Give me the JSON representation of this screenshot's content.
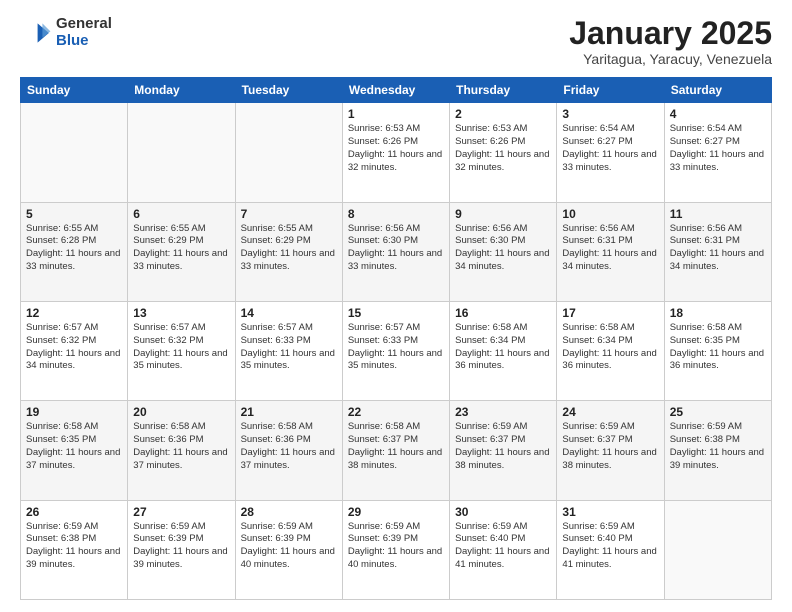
{
  "logo": {
    "general": "General",
    "blue": "Blue"
  },
  "title": "January 2025",
  "subtitle": "Yaritagua, Yaracuy, Venezuela",
  "days": [
    "Sunday",
    "Monday",
    "Tuesday",
    "Wednesday",
    "Thursday",
    "Friday",
    "Saturday"
  ],
  "weeks": [
    [
      {
        "date": "",
        "info": ""
      },
      {
        "date": "",
        "info": ""
      },
      {
        "date": "",
        "info": ""
      },
      {
        "date": "1",
        "info": "Sunrise: 6:53 AM\nSunset: 6:26 PM\nDaylight: 11 hours and 32 minutes."
      },
      {
        "date": "2",
        "info": "Sunrise: 6:53 AM\nSunset: 6:26 PM\nDaylight: 11 hours and 32 minutes."
      },
      {
        "date": "3",
        "info": "Sunrise: 6:54 AM\nSunset: 6:27 PM\nDaylight: 11 hours and 33 minutes."
      },
      {
        "date": "4",
        "info": "Sunrise: 6:54 AM\nSunset: 6:27 PM\nDaylight: 11 hours and 33 minutes."
      }
    ],
    [
      {
        "date": "5",
        "info": "Sunrise: 6:55 AM\nSunset: 6:28 PM\nDaylight: 11 hours and 33 minutes."
      },
      {
        "date": "6",
        "info": "Sunrise: 6:55 AM\nSunset: 6:29 PM\nDaylight: 11 hours and 33 minutes."
      },
      {
        "date": "7",
        "info": "Sunrise: 6:55 AM\nSunset: 6:29 PM\nDaylight: 11 hours and 33 minutes."
      },
      {
        "date": "8",
        "info": "Sunrise: 6:56 AM\nSunset: 6:30 PM\nDaylight: 11 hours and 33 minutes."
      },
      {
        "date": "9",
        "info": "Sunrise: 6:56 AM\nSunset: 6:30 PM\nDaylight: 11 hours and 34 minutes."
      },
      {
        "date": "10",
        "info": "Sunrise: 6:56 AM\nSunset: 6:31 PM\nDaylight: 11 hours and 34 minutes."
      },
      {
        "date": "11",
        "info": "Sunrise: 6:56 AM\nSunset: 6:31 PM\nDaylight: 11 hours and 34 minutes."
      }
    ],
    [
      {
        "date": "12",
        "info": "Sunrise: 6:57 AM\nSunset: 6:32 PM\nDaylight: 11 hours and 34 minutes."
      },
      {
        "date": "13",
        "info": "Sunrise: 6:57 AM\nSunset: 6:32 PM\nDaylight: 11 hours and 35 minutes."
      },
      {
        "date": "14",
        "info": "Sunrise: 6:57 AM\nSunset: 6:33 PM\nDaylight: 11 hours and 35 minutes."
      },
      {
        "date": "15",
        "info": "Sunrise: 6:57 AM\nSunset: 6:33 PM\nDaylight: 11 hours and 35 minutes."
      },
      {
        "date": "16",
        "info": "Sunrise: 6:58 AM\nSunset: 6:34 PM\nDaylight: 11 hours and 36 minutes."
      },
      {
        "date": "17",
        "info": "Sunrise: 6:58 AM\nSunset: 6:34 PM\nDaylight: 11 hours and 36 minutes."
      },
      {
        "date": "18",
        "info": "Sunrise: 6:58 AM\nSunset: 6:35 PM\nDaylight: 11 hours and 36 minutes."
      }
    ],
    [
      {
        "date": "19",
        "info": "Sunrise: 6:58 AM\nSunset: 6:35 PM\nDaylight: 11 hours and 37 minutes."
      },
      {
        "date": "20",
        "info": "Sunrise: 6:58 AM\nSunset: 6:36 PM\nDaylight: 11 hours and 37 minutes."
      },
      {
        "date": "21",
        "info": "Sunrise: 6:58 AM\nSunset: 6:36 PM\nDaylight: 11 hours and 37 minutes."
      },
      {
        "date": "22",
        "info": "Sunrise: 6:58 AM\nSunset: 6:37 PM\nDaylight: 11 hours and 38 minutes."
      },
      {
        "date": "23",
        "info": "Sunrise: 6:59 AM\nSunset: 6:37 PM\nDaylight: 11 hours and 38 minutes."
      },
      {
        "date": "24",
        "info": "Sunrise: 6:59 AM\nSunset: 6:37 PM\nDaylight: 11 hours and 38 minutes."
      },
      {
        "date": "25",
        "info": "Sunrise: 6:59 AM\nSunset: 6:38 PM\nDaylight: 11 hours and 39 minutes."
      }
    ],
    [
      {
        "date": "26",
        "info": "Sunrise: 6:59 AM\nSunset: 6:38 PM\nDaylight: 11 hours and 39 minutes."
      },
      {
        "date": "27",
        "info": "Sunrise: 6:59 AM\nSunset: 6:39 PM\nDaylight: 11 hours and 39 minutes."
      },
      {
        "date": "28",
        "info": "Sunrise: 6:59 AM\nSunset: 6:39 PM\nDaylight: 11 hours and 40 minutes."
      },
      {
        "date": "29",
        "info": "Sunrise: 6:59 AM\nSunset: 6:39 PM\nDaylight: 11 hours and 40 minutes."
      },
      {
        "date": "30",
        "info": "Sunrise: 6:59 AM\nSunset: 6:40 PM\nDaylight: 11 hours and 41 minutes."
      },
      {
        "date": "31",
        "info": "Sunrise: 6:59 AM\nSunset: 6:40 PM\nDaylight: 11 hours and 41 minutes."
      },
      {
        "date": "",
        "info": ""
      }
    ]
  ]
}
